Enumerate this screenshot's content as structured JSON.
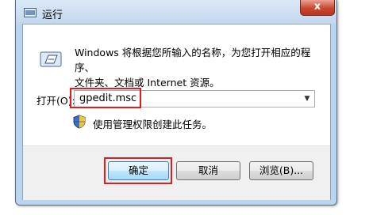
{
  "title_bar": {
    "title": "运行",
    "close_label": "x"
  },
  "description": {
    "line1": "Windows 将根据您所输入的名称，为您打开相应的程序、",
    "line2": "文件夹、文档或 Internet 资源。"
  },
  "open_field": {
    "label": "打开(O):",
    "value": "gpedit.msc",
    "dropdown_glyph": "▼"
  },
  "admin_note": "使用管理权限创建此任务。",
  "buttons": {
    "ok": "确定",
    "cancel": "取消",
    "browse": "浏览(B)..."
  },
  "colors": {
    "highlight_box": "#e01c1c",
    "title_bar": "#c3d7ee",
    "close_button": "#c9472f"
  }
}
